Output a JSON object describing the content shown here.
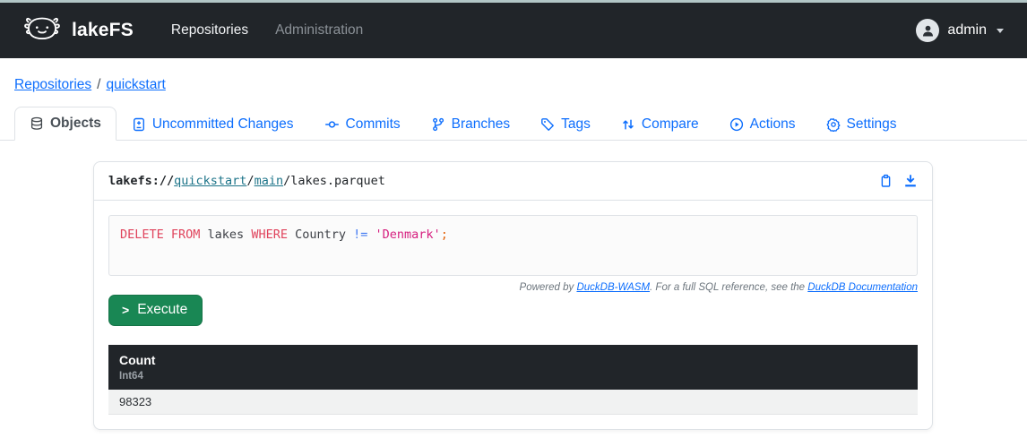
{
  "colors": {
    "navbar_bg": "#212529",
    "accent_blue": "#0d6efd",
    "path_link_teal": "#1d7489",
    "success_green": "#198754",
    "sql_keyword": "#e0435c",
    "sql_string": "#d61f7f",
    "sql_operator": "#4078f2",
    "sql_semicolon": "#e36209",
    "table_header_bg": "#212529",
    "table_row_bg": "#f1f2f2"
  },
  "navbar": {
    "brand": "lakeFS",
    "items": [
      {
        "label": "Repositories"
      },
      {
        "label": "Administration"
      }
    ],
    "user": {
      "label": "admin"
    }
  },
  "breadcrumb": {
    "items": [
      {
        "label": "Repositories"
      },
      {
        "label": "quickstart"
      }
    ],
    "separator": "/"
  },
  "tabs": [
    {
      "label": "Objects",
      "icon": "database-icon",
      "active": true
    },
    {
      "label": "Uncommitted Changes",
      "icon": "file-diff-icon",
      "active": false
    },
    {
      "label": "Commits",
      "icon": "commit-icon",
      "active": false
    },
    {
      "label": "Branches",
      "icon": "git-branch-icon",
      "active": false
    },
    {
      "label": "Tags",
      "icon": "tag-icon",
      "active": false
    },
    {
      "label": "Compare",
      "icon": "compare-icon",
      "active": false
    },
    {
      "label": "Actions",
      "icon": "play-circle-icon",
      "active": false
    },
    {
      "label": "Settings",
      "icon": "gear-icon",
      "active": false
    }
  ],
  "object_viewer": {
    "path": {
      "scheme": "lakefs:// ",
      "repo": "quickstart",
      "sep": " / ",
      "branch": "main",
      "file": "lakes.parquet"
    },
    "actions": [
      "copy",
      "download"
    ],
    "editor": {
      "sql_raw": "DELETE FROM lakes WHERE Country != 'Denmark';",
      "tokens": [
        {
          "type": "keyword",
          "text": "DELETE "
        },
        {
          "type": "keyword",
          "text": "FROM "
        },
        {
          "type": "identifier",
          "text": "lakes "
        },
        {
          "type": "keyword",
          "text": "WHERE "
        },
        {
          "type": "identifier",
          "text": "Country "
        },
        {
          "type": "operator",
          "text": "!= "
        },
        {
          "type": "string",
          "text": "'Denmark'"
        },
        {
          "type": "semicolon",
          "text": ";"
        }
      ]
    },
    "attribution": {
      "prefix": "Powered by ",
      "link1": "DuckDB-WASM",
      "middle": ". For a full SQL reference, see the ",
      "link2": "DuckDB Documentation"
    },
    "execute": {
      "chevron": ">",
      "label": "Execute"
    },
    "result_table": {
      "columns": [
        {
          "name": "Count",
          "type": "Int64"
        }
      ],
      "rows": [
        [
          "98323"
        ]
      ]
    }
  }
}
